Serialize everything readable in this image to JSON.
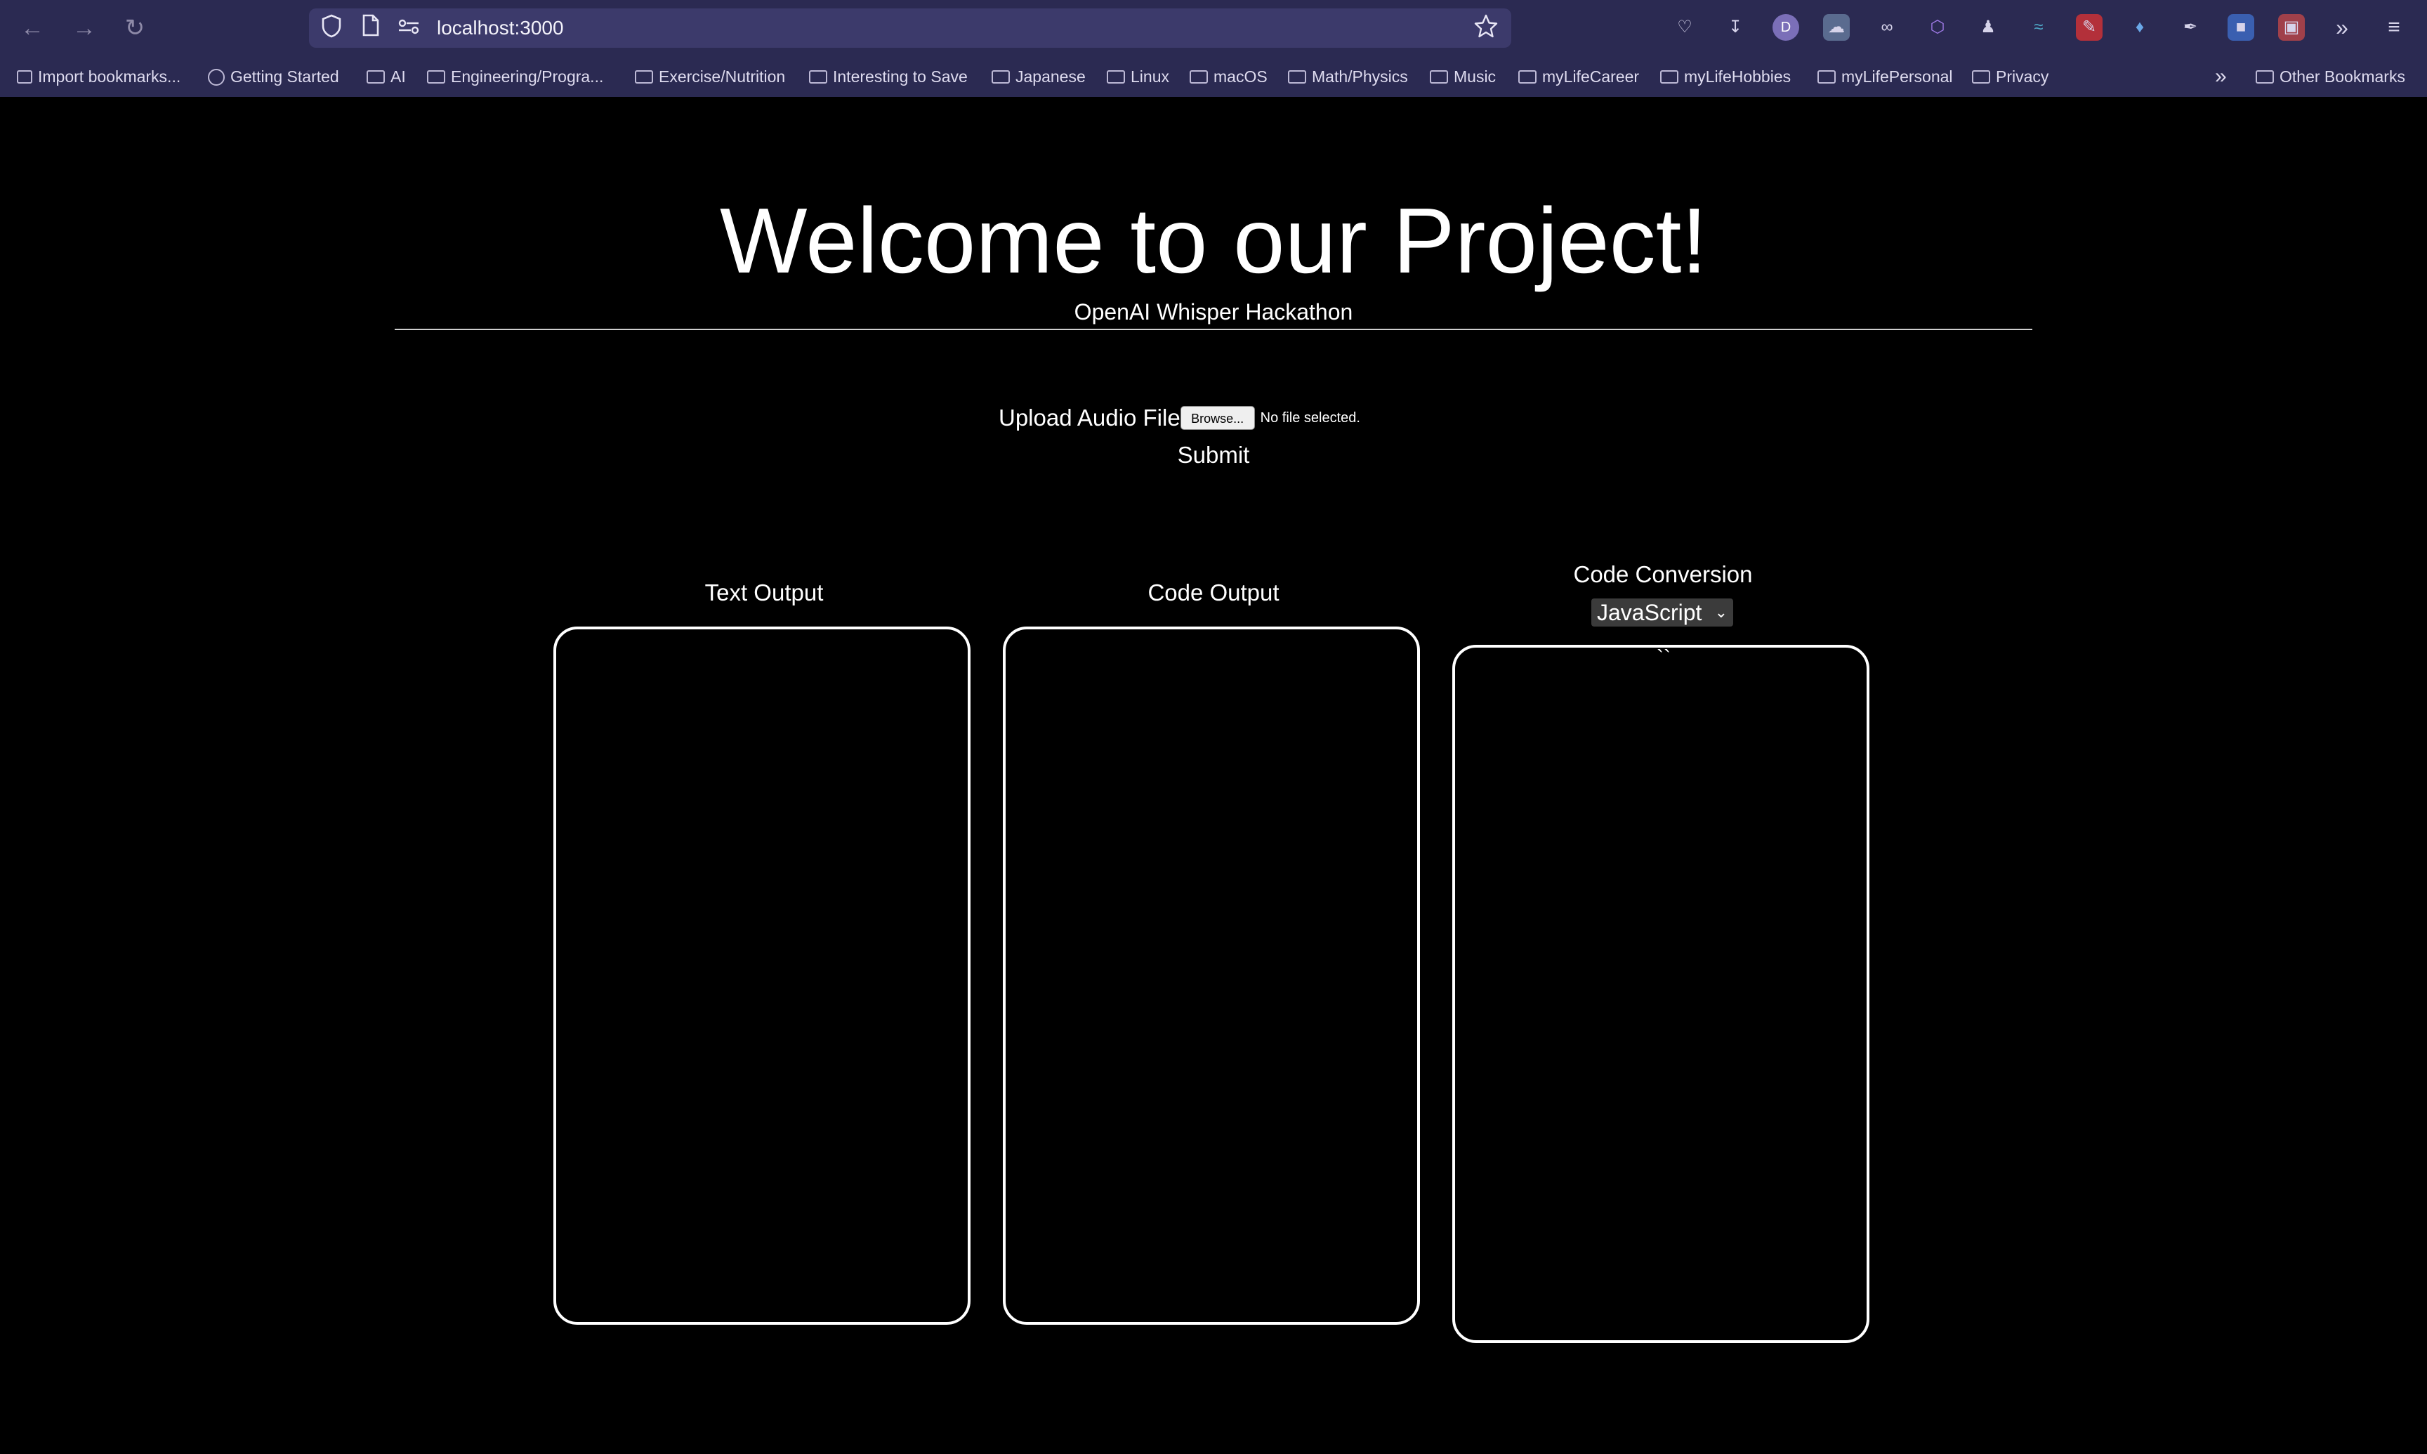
{
  "browser": {
    "url": "localhost:3000",
    "bookmarks": [
      {
        "label": "Import bookmarks...",
        "icon": "import-icon"
      },
      {
        "label": "Getting Started",
        "icon": "globe-icon"
      },
      {
        "label": "AI",
        "icon": "folder-icon"
      },
      {
        "label": "Engineering/Progra...",
        "icon": "folder-icon"
      },
      {
        "label": "Exercise/Nutrition",
        "icon": "folder-icon"
      },
      {
        "label": "Interesting to Save",
        "icon": "folder-icon"
      },
      {
        "label": "Japanese",
        "icon": "folder-icon"
      },
      {
        "label": "Linux",
        "icon": "folder-icon"
      },
      {
        "label": "macOS",
        "icon": "folder-icon"
      },
      {
        "label": "Math/Physics",
        "icon": "folder-icon"
      },
      {
        "label": "Music",
        "icon": "folder-icon"
      },
      {
        "label": "myLifeCareer",
        "icon": "folder-icon"
      },
      {
        "label": "myLifeHobbies",
        "icon": "folder-icon"
      },
      {
        "label": "myLifePersonal",
        "icon": "folder-icon"
      },
      {
        "label": "Privacy",
        "icon": "folder-icon"
      }
    ],
    "other_bookmarks": "Other Bookmarks",
    "colors": {
      "chrome": "#2b2a52",
      "urlbar": "#3c3a6b",
      "page": "#000000",
      "text": "#ffffff"
    }
  },
  "page": {
    "title": "Welcome to our Project!",
    "subtitle": "OpenAI Whisper Hackathon",
    "upload_label": "Upload Audio File",
    "browse_label": "Browse...",
    "file_status": "No file selected.",
    "submit_label": "Submit",
    "text_output_label": "Text Output",
    "code_output_label": "Code Output",
    "code_conversion_label": "Code Conversion",
    "language_selected": "JavaScript",
    "conversion_content": "``"
  }
}
